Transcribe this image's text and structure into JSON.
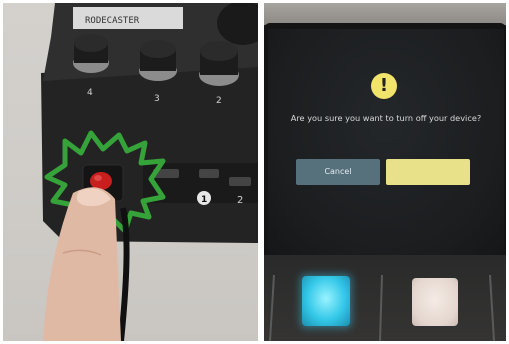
{
  "left_photo": {
    "device_print": {
      "brand_text": "RODECASTER",
      "knob_numbers": [
        "4",
        "3",
        "2"
      ],
      "port_number": "1",
      "port2_number": "2"
    }
  },
  "right_photo": {
    "dialog": {
      "question": "Are you sure you want to turn off your device?",
      "cancel_label": "Cancel"
    }
  },
  "colors": {
    "highlight_outline": "#35a33a",
    "power_button": "#c81e1e",
    "warning_icon": "#f1e46a",
    "cancel_button": "#56707c",
    "confirm_button": "#e9e08a",
    "pad_blue": "#34c8e8",
    "pad_white": "#e4d6cf"
  }
}
